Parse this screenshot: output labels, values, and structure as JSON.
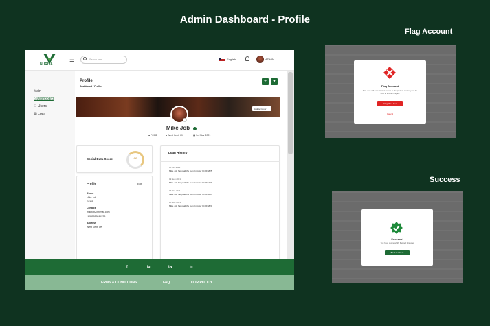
{
  "page": {
    "title": "Admin Dashboard - Profile"
  },
  "panels": {
    "flag_title": "Flag Account",
    "success_title": "Success"
  },
  "app": {
    "logo_text": "NURIVA",
    "search_placeholder": "Search here",
    "language": "English",
    "user_menu": "ADMIN"
  },
  "sidebar": {
    "section": "Main",
    "items": [
      {
        "label": "Dashboard",
        "icon": "home-icon",
        "active": true
      },
      {
        "label": "Users",
        "icon": "users-icon",
        "active": false
      },
      {
        "label": "Loan",
        "icon": "document-icon",
        "active": false
      }
    ]
  },
  "profile": {
    "title": "Profile",
    "breadcrumb": "Dashboard / Profile",
    "cover_button": "Update Cover",
    "name": "Mike Job",
    "meta": [
      {
        "icon": "id-icon",
        "text": "FCMB"
      },
      {
        "icon": "location-icon",
        "text": "West Kent, UK"
      },
      {
        "icon": "calendar-icon",
        "text": "3rd Nov 2021"
      }
    ],
    "score_card": {
      "title": "Social Data Score",
      "value": "6/6"
    },
    "info_card": {
      "title": "Profile",
      "edit": "Edit",
      "sections": [
        {
          "label": "About",
          "lines": [
            "Mike Job",
            "FCMB"
          ]
        },
        {
          "label": "Contact",
          "lines": [
            "mikejob2@gmail.com",
            "+2345553414733"
          ]
        },
        {
          "label": "Address",
          "lines": [
            "West Kent, UK"
          ]
        }
      ]
    },
    "loan_history": {
      "title": "Loan History",
      "entries": [
        {
          "date": "05 Oct 2021",
          "text": "Mike Job has paid the loan. Invoice YCRF5825"
        },
        {
          "date": "09 Sep 2021",
          "text": "Mike Job has paid the loan. Invoice YCRF5209"
        },
        {
          "date": "07 Jan 2021",
          "text": "Mike Job has paid the loan. Invoice YCRF5637"
        },
        {
          "date": "10 Nov 2021",
          "text": "Mike Job has paid the loan. Invoice YCRF5820"
        }
      ]
    }
  },
  "footer": {
    "social": [
      "f",
      "ig",
      "tw",
      "in"
    ],
    "links": [
      "TERMS & CONDITIONS",
      "FAQ",
      "OUR POLICY"
    ]
  },
  "flag_modal": {
    "title": "Flag Account",
    "subtitle": "This user will have limited access to the product and may not be able to access it again",
    "confirm": "Flag this User",
    "cancel": "Cancel"
  },
  "success_modal": {
    "title": "Success!",
    "subtitle": "You have successfully flagged this user",
    "button": "Back to Users"
  },
  "colors": {
    "brand": "#1e6b35",
    "danger": "#e02424",
    "background": "#0f3320"
  }
}
